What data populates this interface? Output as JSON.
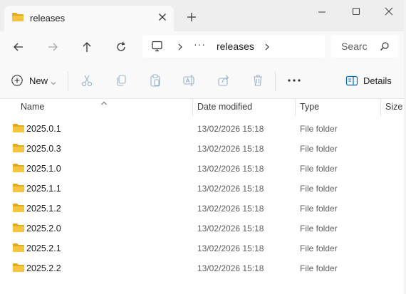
{
  "window": {
    "tab_title": "releases",
    "tab_icon": "folder-icon",
    "colors": {
      "folder": "#f5c542",
      "folder_dark": "#e0a91f",
      "accent": "#0067c0"
    }
  },
  "nav": {
    "back": "back-arrow-icon",
    "forward": "forward-arrow-icon",
    "up": "up-arrow-icon",
    "refresh": "refresh-icon",
    "address": {
      "overflow": "···",
      "current": "releases"
    },
    "search": {
      "placeholder": "Searc"
    }
  },
  "toolbar": {
    "new_label": "New",
    "details_label": "Details",
    "icons": [
      "cut-icon",
      "copy-icon",
      "paste-icon",
      "rename-icon",
      "share-icon",
      "delete-icon",
      "more-icon"
    ]
  },
  "columns": [
    "Name",
    "Date modified",
    "Type",
    "Size"
  ],
  "rows": [
    {
      "name": "2025.0.1",
      "date": "13/02/2026 15:18",
      "type": "File folder"
    },
    {
      "name": "2025.0.3",
      "date": "13/02/2026 15:18",
      "type": "File folder"
    },
    {
      "name": "2025.1.0",
      "date": "13/02/2026 15:18",
      "type": "File folder"
    },
    {
      "name": "2025.1.1",
      "date": "13/02/2026 15:18",
      "type": "File folder"
    },
    {
      "name": "2025.1.2",
      "date": "13/02/2026 15:18",
      "type": "File folder"
    },
    {
      "name": "2025.2.0",
      "date": "13/02/2026 15:18",
      "type": "File folder"
    },
    {
      "name": "2025.2.1",
      "date": "13/02/2026 15:18",
      "type": "File folder"
    },
    {
      "name": "2025.2.2",
      "date": "13/02/2026 15:18",
      "type": "File folder"
    }
  ]
}
